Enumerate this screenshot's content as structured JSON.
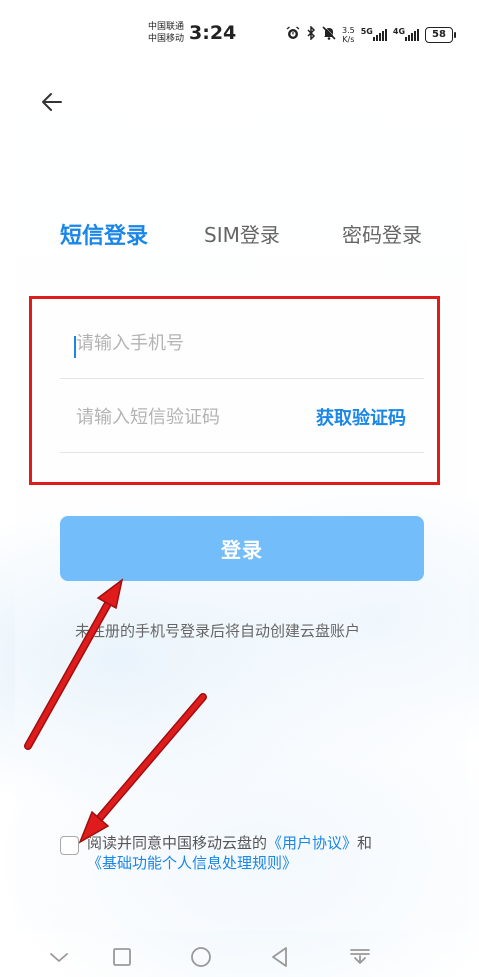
{
  "status_bar": {
    "carrier_1": "中国联通",
    "carrier_2": "中国移动",
    "time": "3:24",
    "net_speed_value": "3.5",
    "net_speed_unit": "K/s",
    "signal_1_label": "5G",
    "signal_2_label": "4G",
    "battery": "58",
    "icons": [
      "alarm-icon",
      "bluetooth-icon",
      "mute-bell-icon",
      "signal-5g-icon",
      "signal-4g-icon",
      "battery-icon"
    ]
  },
  "header": {
    "back_icon": "arrow-left-icon"
  },
  "tabs": [
    {
      "label": "短信登录",
      "active": true
    },
    {
      "label": "SIM登录",
      "active": false
    },
    {
      "label": "密码登录",
      "active": false
    }
  ],
  "form": {
    "phone_placeholder": "请输入手机号",
    "phone_value": "",
    "code_placeholder": "请输入短信验证码",
    "code_value": "",
    "get_code_label": "获取验证码"
  },
  "login_button": {
    "label": "登录"
  },
  "hint": "未注册的手机号登录后将自动创建云盘账户",
  "agreement": {
    "checked": false,
    "prefix": "阅读并同意中国移动云盘的",
    "user_agreement": "《用户协议》",
    "and": "和",
    "privacy_rules": "《基础功能个人信息处理规则》"
  },
  "annotations": {
    "frame_color": "#e01b1b",
    "arrow_color": "#e01b1b"
  },
  "colors": {
    "accent": "#1a86e8",
    "button": "#74bdfb"
  },
  "nav_bar": {
    "icons": [
      "collapse-chevron-icon",
      "recent-apps-icon",
      "home-icon",
      "back-triangle-icon",
      "notification-pull-icon"
    ]
  }
}
